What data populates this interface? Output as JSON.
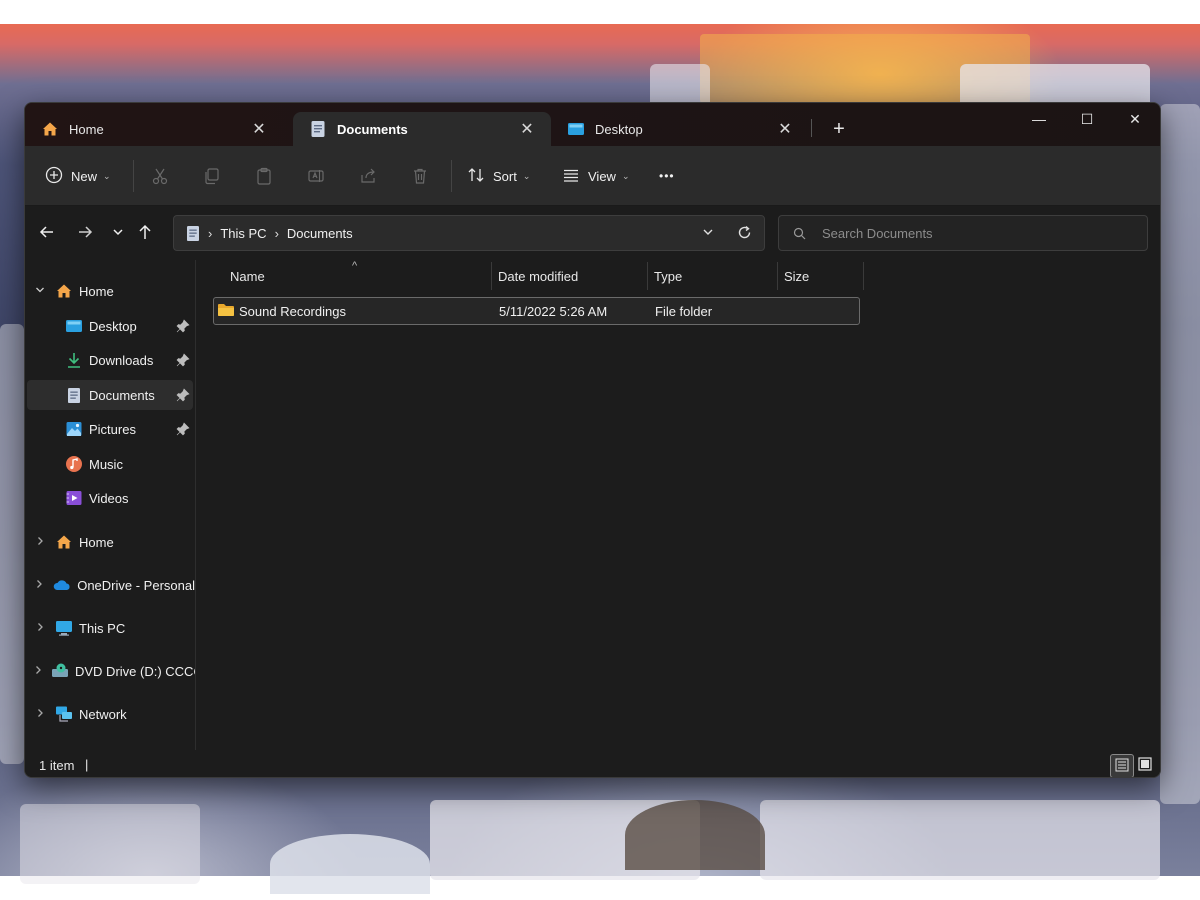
{
  "window": {
    "tabs": [
      {
        "label": "Home",
        "icon": "home-icon",
        "close": "✕"
      },
      {
        "label": "Documents",
        "icon": "documents-icon",
        "close": "✕"
      },
      {
        "label": "Desktop",
        "icon": "desktop-icon",
        "close": "✕"
      }
    ],
    "new_tab": "+",
    "controls": {
      "minimize": "—",
      "maximize": "☐",
      "close": "✕"
    }
  },
  "toolbar": {
    "new_label": "New",
    "sort_label": "Sort",
    "view_label": "View",
    "more_label": "•••",
    "icons": [
      "cut-icon",
      "copy-icon",
      "paste-icon",
      "rename-icon",
      "share-icon",
      "delete-icon"
    ]
  },
  "navigation": {
    "breadcrumb": [
      "This PC",
      "Documents"
    ],
    "crumb_separator": "›",
    "search_placeholder": "Search Documents"
  },
  "sidebar": {
    "items": [
      {
        "label": "Home",
        "icon": "home-icon",
        "expander": "⌄"
      },
      {
        "label": "Desktop",
        "icon": "desktop-icon",
        "pinned": true
      },
      {
        "label": "Downloads",
        "icon": "downloads-icon",
        "pinned": true
      },
      {
        "label": "Documents",
        "icon": "documents-icon",
        "pinned": true,
        "selected": true
      },
      {
        "label": "Pictures",
        "icon": "pictures-icon",
        "pinned": true
      },
      {
        "label": "Music",
        "icon": "music-icon"
      },
      {
        "label": "Videos",
        "icon": "videos-icon"
      },
      {
        "label": "Home",
        "icon": "home-icon",
        "expander": "›"
      },
      {
        "label": "OneDrive - Personal",
        "icon": "onedrive-icon",
        "expander": "›"
      },
      {
        "label": "This PC",
        "icon": "this-pc-icon",
        "expander": "›"
      },
      {
        "label": "DVD Drive (D:) CCCOMA",
        "icon": "dvd-drive-icon",
        "expander": "›"
      },
      {
        "label": "Network",
        "icon": "network-icon",
        "expander": "›"
      }
    ]
  },
  "file_list": {
    "columns": [
      "Name",
      "Date modified",
      "Type",
      "Size"
    ],
    "sort_indicator": "^",
    "rows": [
      {
        "name": "Sound Recordings",
        "date_modified": "5/11/2022 5:26 AM",
        "type": "File folder",
        "size": "",
        "icon": "folder-icon"
      }
    ]
  },
  "status": {
    "item_count": "1 item",
    "separator": "|"
  },
  "colors": {
    "window_bg": "#1c1c1c",
    "toolbar_bg": "#2b2b2b",
    "folder_yellow": "#f5c242",
    "accent_blue": "#2aa0e0"
  }
}
